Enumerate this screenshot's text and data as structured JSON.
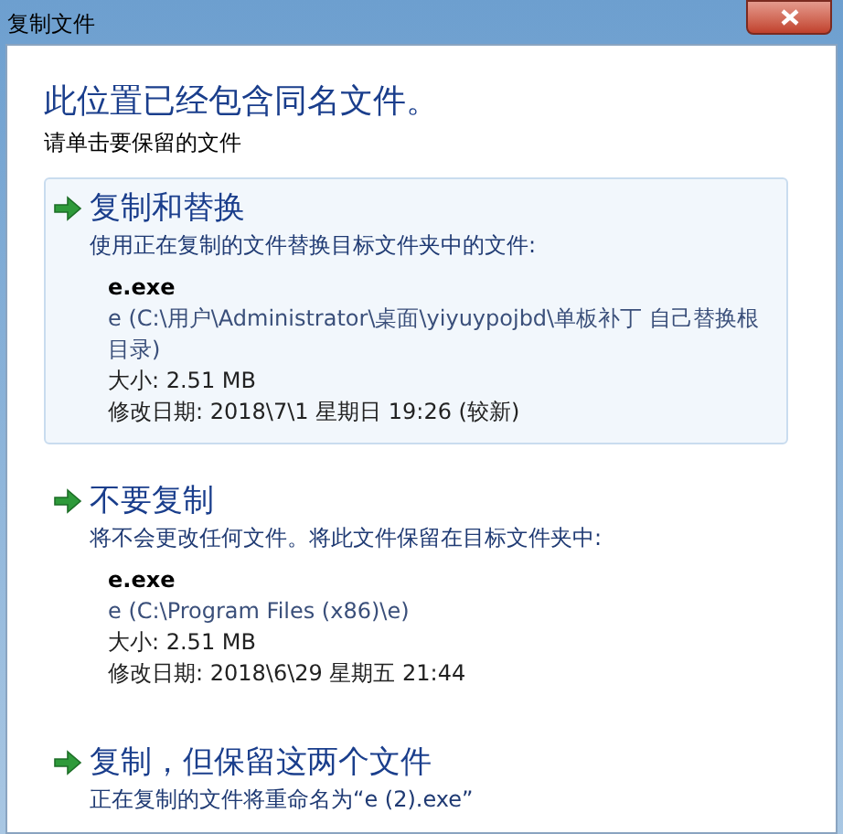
{
  "window": {
    "title": "复制文件"
  },
  "heading": "此位置已经包含同名文件。",
  "instruction": "请单击要保留的文件",
  "options": [
    {
      "title": "复制和替换",
      "description": "使用正在复制的文件替换目标文件夹中的文件:",
      "selected": true,
      "file": {
        "name": "e.exe",
        "location": "e (C:\\用户\\Administrator\\桌面\\yiyuypojbd\\单板补丁 自己替换根目录)",
        "size": "大小: 2.51 MB",
        "modified": "修改日期: 2018\\7\\1 星期日 19:26 (较新)"
      }
    },
    {
      "title": "不要复制",
      "description": "将不会更改任何文件。将此文件保留在目标文件夹中:",
      "selected": false,
      "file": {
        "name": "e.exe",
        "location": "e (C:\\Program Files (x86)\\e)",
        "size": "大小: 2.51 MB",
        "modified": "修改日期: 2018\\6\\29 星期五 21:44"
      }
    },
    {
      "title": "复制，但保留这两个文件",
      "description": "正在复制的文件将重命名为“e (2).exe”",
      "selected": false
    }
  ]
}
